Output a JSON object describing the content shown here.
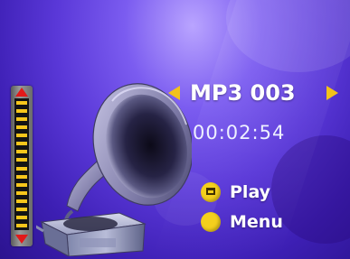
{
  "player": {
    "track_title": "MP3 003",
    "elapsed_time": "00:02:54"
  },
  "volume": {
    "level": 1.0,
    "segments": 16
  },
  "buttons": {
    "play_label": "Play",
    "menu_label": "Menu"
  },
  "icons": {
    "previous": "triangle-left-icon",
    "next": "triangle-right-icon",
    "volume_up": "volume-up-arrow-icon",
    "volume_down": "volume-down-arrow-icon",
    "play_key": "yellow-key-icon",
    "menu_key": "yellow-key-icon",
    "art": "gramophone-icon"
  },
  "colors": {
    "accent": "#f2c21a",
    "volume_arrows": "#e11a1a",
    "background": "#5a38d8"
  }
}
